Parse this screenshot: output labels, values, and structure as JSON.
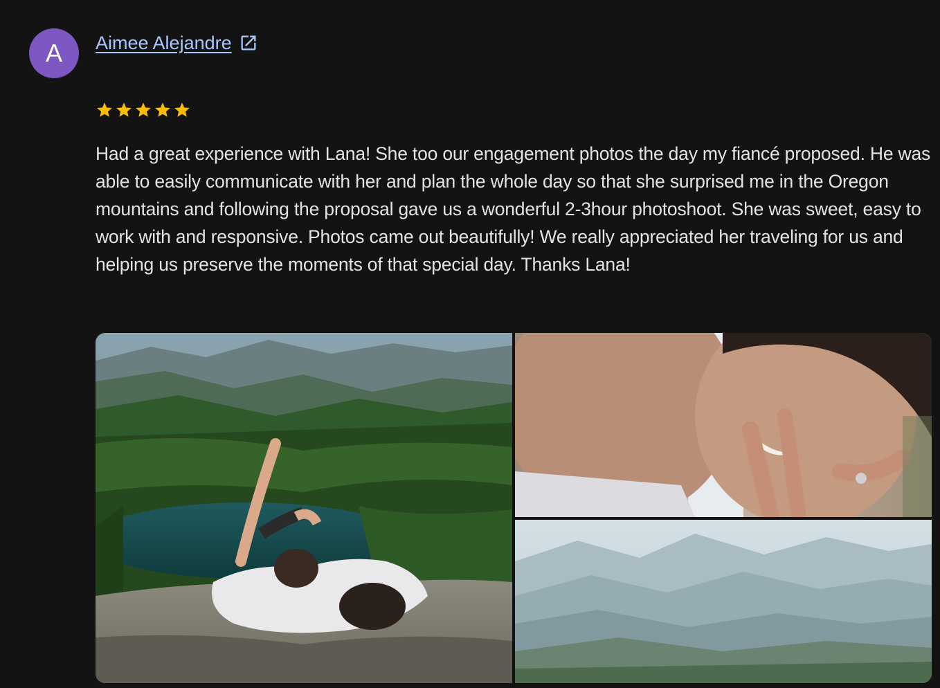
{
  "review": {
    "avatar_initial": "A",
    "author_name": "Aimee Alejandre",
    "rating": 5,
    "rating_max": 5,
    "star_color": "#fbbc04",
    "avatar_color": "#7e57c2",
    "link_color": "#a8c7fa",
    "text": "Had a great experience with Lana! She too our engagement photos the day my fiancé proposed. He was able to easily communicate with her and plan the whole day so that she surprised me in the Oregon mountains and following the proposal gave us a wonderful 2-3hour photoshoot. She was sweet, easy to work with and responsive. Photos came out beautifully! We really appreciated her traveling for us and helping us preserve the moments of that special day. Thanks Lana!",
    "icons": {
      "external": "open-in-new-icon",
      "star": "star-icon"
    },
    "photos": [
      {
        "subject": "couple lying on rock above mountain lake"
      },
      {
        "subject": "couple close-up nose to nose smiling"
      },
      {
        "subject": "hazy mountain range landscape"
      }
    ]
  }
}
